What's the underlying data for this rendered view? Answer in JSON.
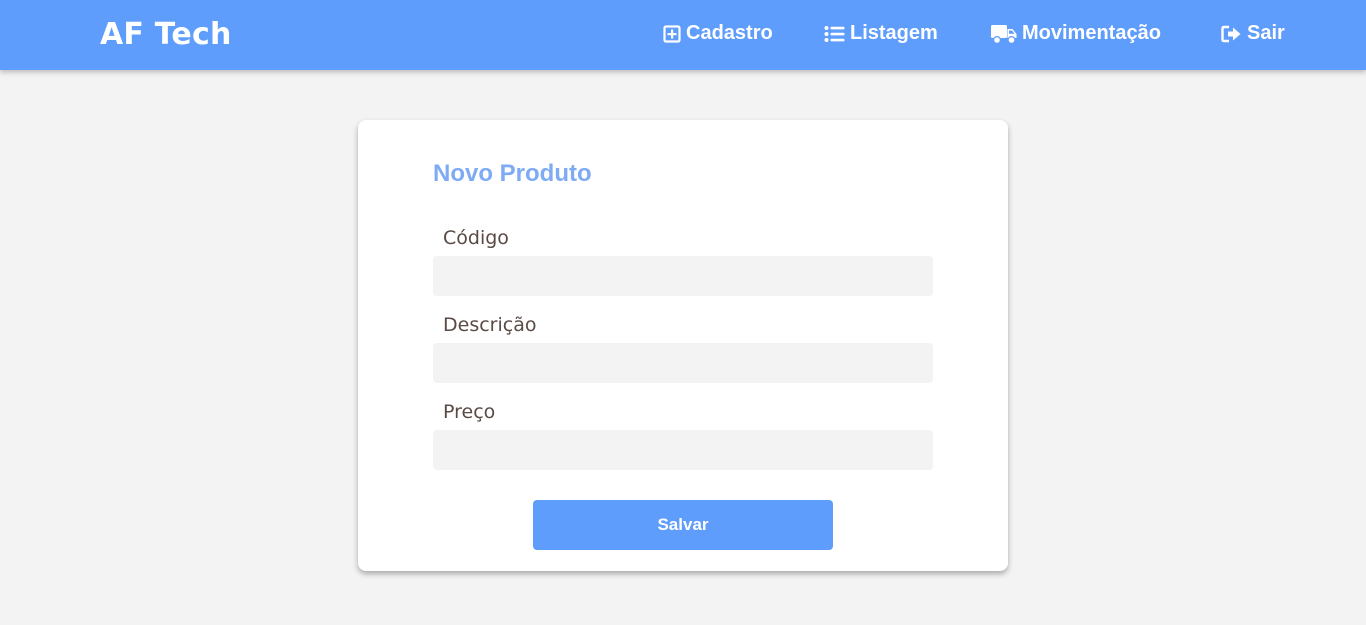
{
  "navbar": {
    "brand": "AF Tech",
    "items": [
      {
        "label": "Cadastro",
        "icon": "plus-square-icon"
      },
      {
        "label": "Listagem",
        "icon": "list-icon"
      },
      {
        "label": "Movimentação",
        "icon": "truck-icon"
      },
      {
        "label": "Sair",
        "icon": "sign-out-icon"
      }
    ]
  },
  "form": {
    "title": "Novo Produto",
    "fields": [
      {
        "label": "Código",
        "value": ""
      },
      {
        "label": "Descrição",
        "value": ""
      },
      {
        "label": "Preço",
        "value": ""
      }
    ],
    "submit_label": "Salvar"
  },
  "colors": {
    "primary": "#5e9dfc",
    "title": "#7eabf4",
    "background": "#f3f3f3",
    "label": "#5a4a45"
  }
}
